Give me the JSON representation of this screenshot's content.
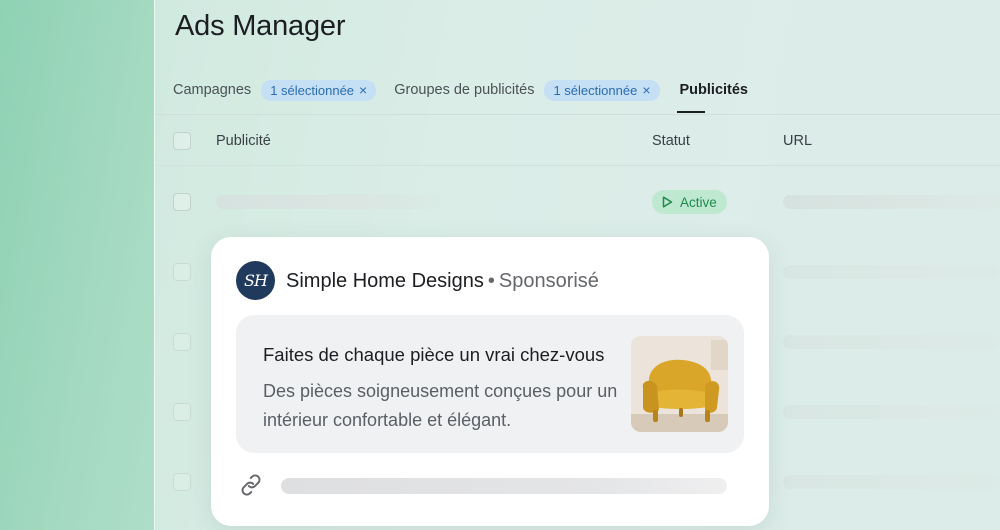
{
  "app": {
    "title": "Ads Manager"
  },
  "tabs": {
    "campaigns_label": "Campagnes",
    "campaigns_chip": "1 sélectionnée",
    "adsets_label": "Groupes de publicités",
    "adsets_chip": "1 sélectionnée",
    "ads_label": "Publicités",
    "chip_close_glyph": "×"
  },
  "table": {
    "columns": {
      "ad": "Publicité",
      "status": "Statut",
      "url": "URL"
    },
    "rows": [
      {
        "status": "Active"
      }
    ]
  },
  "ad_preview": {
    "avatar_initials": "SH",
    "advertiser": "Simple Home Designs",
    "separator": "•",
    "sponsored_label": "Sponsorisé",
    "headline": "Faites de chaque pièce un vrai chez-vous",
    "description": "Des pièces soigneusement conçues pour un intérieur confortable et élégant.",
    "image_icon": "yellow-armchair",
    "link_icon": "link-icon"
  },
  "colors": {
    "accent_chip_bg": "#c5e0f4",
    "accent_chip_text": "#2b6cb0",
    "status_active_bg": "#bfe8d0",
    "status_active_text": "#1e8a4c",
    "avatar_bg": "#203a5e"
  }
}
